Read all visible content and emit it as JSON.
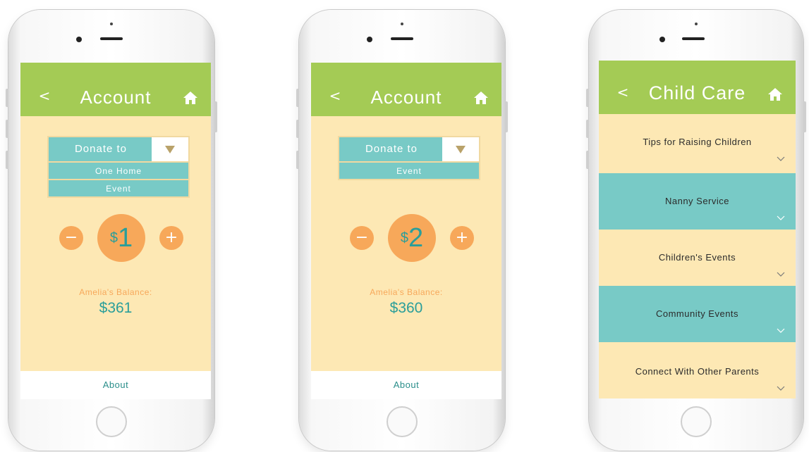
{
  "screens": [
    {
      "header": {
        "back_icon": "<",
        "title": "Account",
        "home_icon": "house-icon"
      },
      "dropdown": {
        "label": "Donate to",
        "toggle_icon": "triangle-down-icon",
        "options": [
          "One Home",
          "Event"
        ]
      },
      "stepper": {
        "minus": "−",
        "currency": "$",
        "amount": "1",
        "plus": "+"
      },
      "balance": {
        "label": "Amelia's Balance:",
        "value": "$361"
      },
      "footer": {
        "label": "About"
      }
    },
    {
      "header": {
        "back_icon": "<",
        "title": "Account",
        "home_icon": "house-icon"
      },
      "dropdown": {
        "label": "Donate to",
        "toggle_icon": "triangle-down-icon",
        "options": [
          "Event"
        ]
      },
      "stepper": {
        "minus": "−",
        "currency": "$",
        "amount": "2",
        "plus": "+"
      },
      "balance": {
        "label": "Amelia's Balance:",
        "value": "$360"
      },
      "footer": {
        "label": "About"
      }
    },
    {
      "header": {
        "back_icon": "<",
        "title": "Child Care",
        "home_icon": "house-icon"
      },
      "menu": [
        {
          "label": "Tips for Raising Children",
          "style": "yellow"
        },
        {
          "label": "Nanny Service",
          "style": "teal"
        },
        {
          "label": "Children's Events",
          "style": "yellow"
        },
        {
          "label": "Community Events",
          "style": "teal"
        },
        {
          "label": "Connect With Other Parents",
          "style": "yellow"
        }
      ]
    }
  ],
  "colors": {
    "header_green": "#a4cb55",
    "background_cream": "#fde8b4",
    "teal": "#78cac6",
    "orange": "#f7a85a",
    "amount_teal": "#2a9e9a"
  }
}
